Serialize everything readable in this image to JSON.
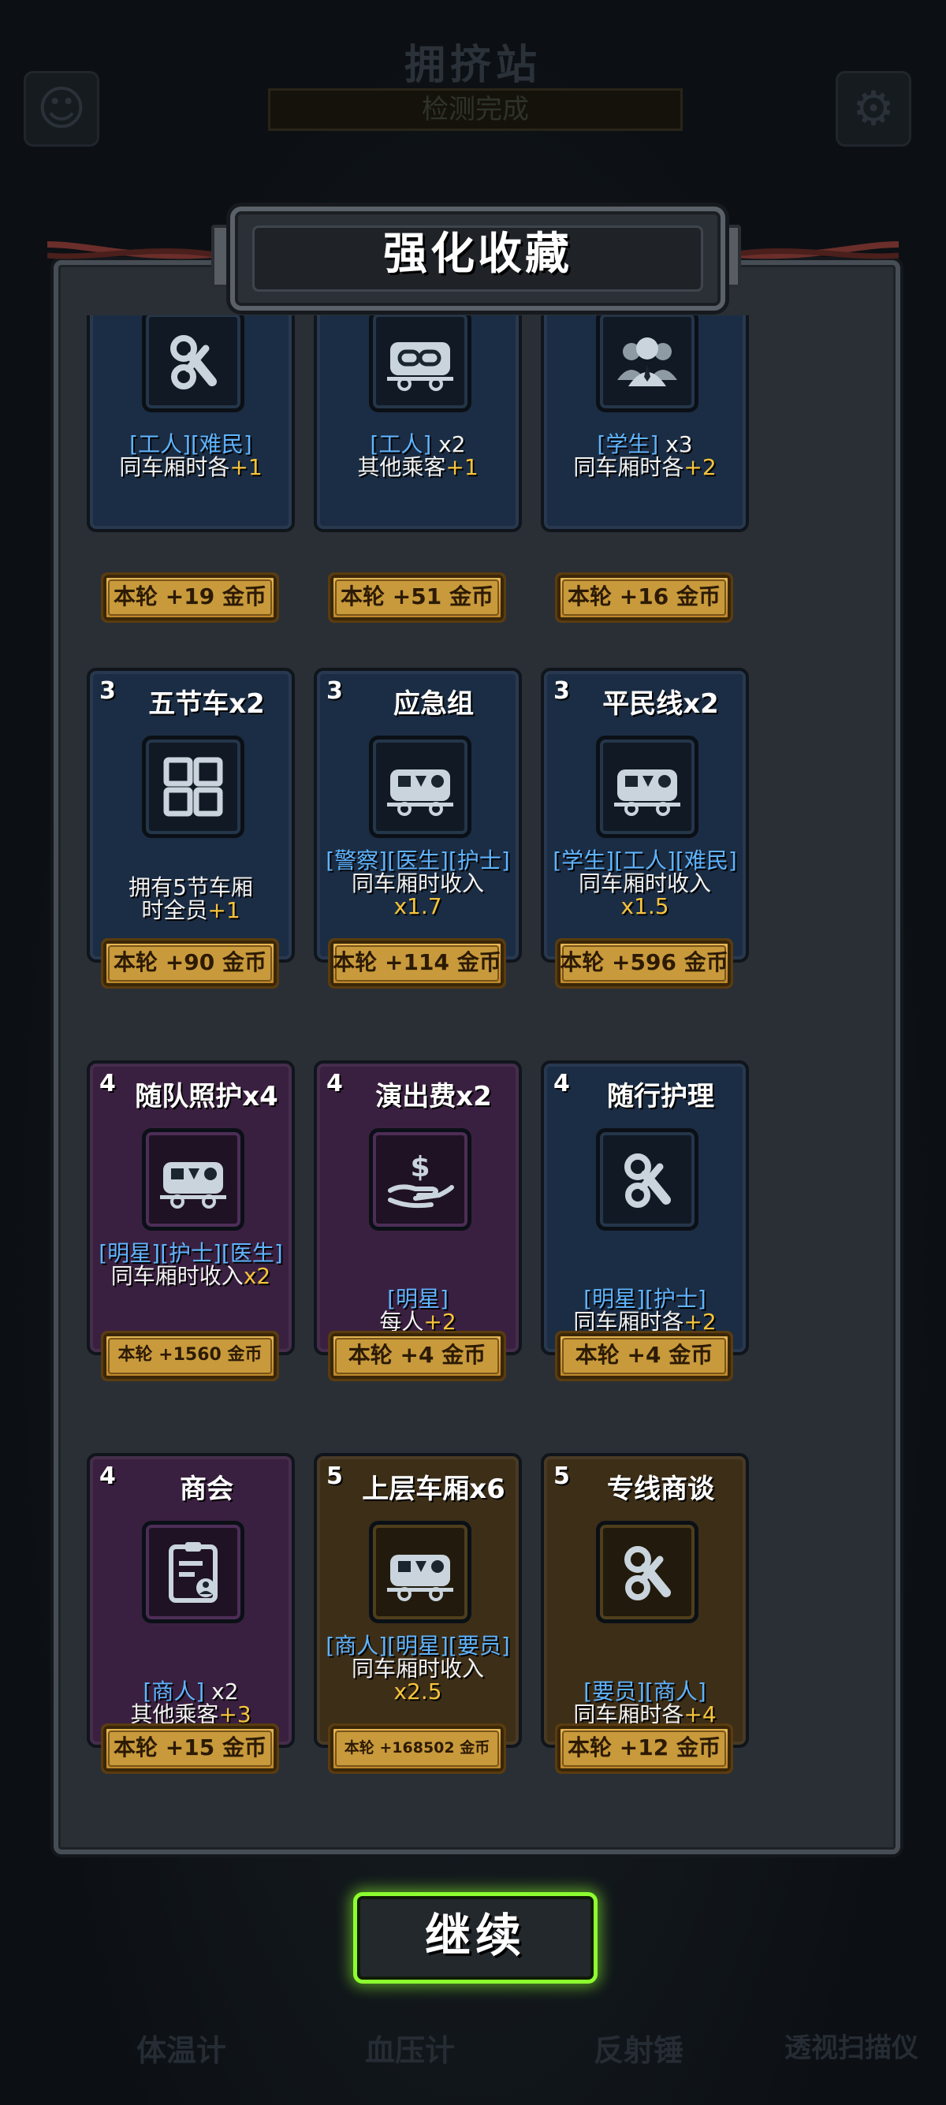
{
  "background": {
    "title": "拥挤站",
    "subtitle": "检测完成",
    "bottom_tabs": [
      "体温计",
      "血压计",
      "反射锤",
      "透视扫描仪"
    ]
  },
  "dialog": {
    "title": "强化收藏",
    "continue_label": "继续"
  },
  "cards": [
    {
      "tier": "",
      "name": "",
      "color": "blue",
      "icon": "key-wrench-icon",
      "tags": "[工人][难民]",
      "line1": "同车厢时各",
      "bonus": "+1",
      "line2": "",
      "reward": "本轮 +19 金币"
    },
    {
      "tier": "",
      "name": "",
      "color": "blue",
      "icon": "linked-wagon-icon",
      "tags": "[工人]",
      "mult": " x2",
      "line1": "其他乘客",
      "bonus": "+1",
      "line2": "",
      "reward": "本轮 +51 金币"
    },
    {
      "tier": "",
      "name": "",
      "color": "blue",
      "icon": "group-icon",
      "tags": "[学生]",
      "mult": " x3",
      "line1": "同车厢时各",
      "bonus": "+2",
      "line2": "",
      "reward": "本轮 +16 金币"
    },
    {
      "tier": "3",
      "name": "五节车x2",
      "color": "blue",
      "icon": "four-squares-icon",
      "tags": "",
      "line1": "拥有5节车厢",
      "line2": "时全员",
      "bonus": "+1",
      "reward": "本轮 +90 金币"
    },
    {
      "tier": "3",
      "name": "应急组",
      "color": "blue",
      "icon": "wagon-icon",
      "tags": "[警察][医生][护士]",
      "line1": "同车厢时收入",
      "bonus": "x1.7",
      "reward": "本轮 +114 金币"
    },
    {
      "tier": "3",
      "name": "平民线x2",
      "color": "blue",
      "icon": "wagon-icon",
      "tags": "[学生][工人][难民]",
      "line1": "同车厢时收入",
      "bonus": "x1.5",
      "reward": "本轮 +596 金币"
    },
    {
      "tier": "4",
      "name": "随队照护x4",
      "color": "purple",
      "icon": "wagon-icon",
      "tags": "[明星][护士][医生]",
      "line1": "同车厢时收入",
      "bonus": "x2",
      "reward": "本轮 +1560 金币"
    },
    {
      "tier": "4",
      "name": "演出费x2",
      "color": "purple",
      "icon": "money-hand-icon",
      "tags": "[明星]",
      "line1": "每人",
      "bonus": "+2",
      "reward": "本轮 +4 金币"
    },
    {
      "tier": "4",
      "name": "随行护理",
      "color": "blue",
      "icon": "key-wrench-icon",
      "tags": "[明星][护士]",
      "line1": "同车厢时各",
      "bonus": "+2",
      "reward": "本轮 +4 金币"
    },
    {
      "tier": "4",
      "name": "商会",
      "color": "purple",
      "icon": "badge-icon",
      "tags": "[商人]",
      "mult": " x2",
      "line1": "其他乘客",
      "bonus": "+3",
      "reward": "本轮 +15 金币"
    },
    {
      "tier": "5",
      "name": "上层车厢x6",
      "color": "gold",
      "icon": "wagon-icon",
      "tags": "[商人][明星][要员]",
      "line1": "同车厢时收入",
      "bonus": "x2.5",
      "reward": "本轮 +168502 金币"
    },
    {
      "tier": "5",
      "name": "专线商谈",
      "color": "gold",
      "icon": "key-wrench-icon",
      "tags": "[要员][商人]",
      "line1": "同车厢时各",
      "bonus": "+4",
      "reward": "本轮 +12 金币"
    }
  ]
}
